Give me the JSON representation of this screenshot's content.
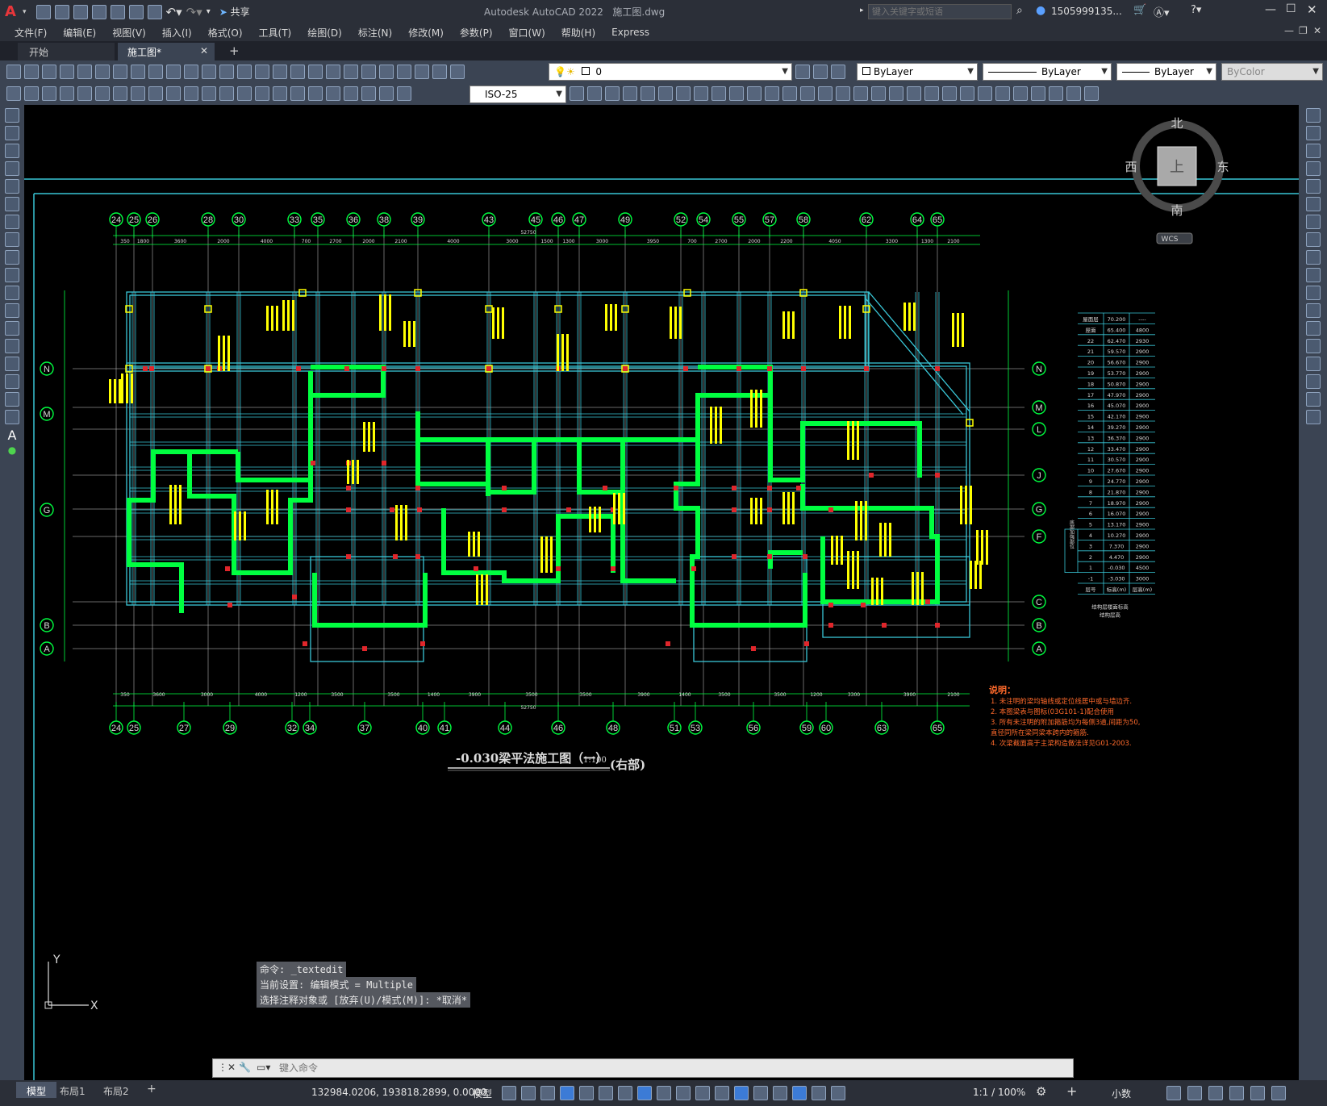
{
  "app": {
    "title": "Autodesk AutoCAD 2022",
    "file": "施工图.dwg",
    "search_placeholder": "键入关键字或短语",
    "user": "1505999135...",
    "share": "共享"
  },
  "menu": [
    "文件(F)",
    "编辑(E)",
    "视图(V)",
    "插入(I)",
    "格式(O)",
    "工具(T)",
    "绘图(D)",
    "标注(N)",
    "修改(M)",
    "参数(P)",
    "窗口(W)",
    "帮助(H)",
    "Express"
  ],
  "tabs": {
    "start": "开始",
    "active": "施工图*",
    "add": "+"
  },
  "toolbar": {
    "layer": "0",
    "color": "ByLayer",
    "linetype": "ByLayer",
    "lineweight": "ByLayer",
    "plotstyle": "ByColor",
    "dimstyle": "ISO-25"
  },
  "viewcube": {
    "north": "北",
    "south": "南",
    "west": "西",
    "east": "东",
    "top": "上",
    "wcs": "WCS"
  },
  "drawing": {
    "top_axes": [
      "24",
      "25",
      "26",
      "28",
      "30",
      "33",
      "35",
      "36",
      "38",
      "39",
      "43",
      "45",
      "46",
      "47",
      "49",
      "52",
      "54",
      "55",
      "57",
      "58",
      "62",
      "64",
      "65"
    ],
    "bottom_axes": [
      "24",
      "25",
      "27",
      "29",
      "32",
      "34",
      "37",
      "40",
      "41",
      "44",
      "46",
      "48",
      "51",
      "53",
      "56",
      "59",
      "60",
      "63",
      "65"
    ],
    "row_axes_left": [
      "N",
      "M",
      "G",
      "B",
      "A"
    ],
    "row_axes_right": [
      "N",
      "M",
      "L",
      "J",
      "G",
      "F",
      "C",
      "B",
      "A"
    ],
    "total_dim": "52750",
    "top_dims": [
      "350",
      "1800",
      "3600",
      "2000",
      "4000",
      "700",
      "2700",
      "2000",
      "2100",
      "4000",
      "3000",
      "1500",
      "1300",
      "3000",
      "3950",
      "700",
      "2700",
      "2000",
      "2200",
      "4050",
      "3300",
      "1300",
      "2100"
    ],
    "bottom_dims": [
      "350",
      "3600",
      "3000",
      "4000",
      "1200",
      "3500",
      "3500",
      "1400",
      "3900",
      "3500",
      "3500",
      "3900",
      "1400",
      "3500",
      "3500",
      "1200",
      "3300",
      "3900",
      "2100"
    ],
    "caption": "-0.030梁平法施工图（一）",
    "scale": "1:100",
    "caption_suffix": "(右部)",
    "notes_title": "说明：",
    "notes": [
      "1. 未注明的梁均轴线或定位线居中或与墙边齐.",
      "2. 本图梁表与图标(03G101-1)配合使用",
      "3. 所有未注明的附加箍筋均为每侧3道,间距为50,",
      "   直径同所在梁同梁本跨内的箍筋.",
      "4. 次梁截面高于主梁构造做法详见G01-2003."
    ],
    "floor_table": {
      "header": [
        "层号",
        "标高(m)",
        "层高(m)"
      ],
      "rows": [
        [
          "屋面层",
          "70.200",
          "----"
        ],
        [
          "屋面",
          "65.400",
          "4800"
        ],
        [
          "22",
          "62.470",
          "2930"
        ],
        [
          "21",
          "59.570",
          "2900"
        ],
        [
          "20",
          "56.670",
          "2900"
        ],
        [
          "19",
          "53.770",
          "2900"
        ],
        [
          "18",
          "50.870",
          "2900"
        ],
        [
          "17",
          "47.970",
          "2900"
        ],
        [
          "16",
          "45.070",
          "2900"
        ],
        [
          "15",
          "42.170",
          "2900"
        ],
        [
          "14",
          "39.270",
          "2900"
        ],
        [
          "13",
          "36.370",
          "2900"
        ],
        [
          "12",
          "33.470",
          "2900"
        ],
        [
          "11",
          "30.570",
          "2900"
        ],
        [
          "10",
          "27.670",
          "2900"
        ],
        [
          "9",
          "24.770",
          "2900"
        ],
        [
          "8",
          "21.870",
          "2900"
        ],
        [
          "7",
          "18.970",
          "2900"
        ],
        [
          "6",
          "16.070",
          "2900"
        ],
        [
          "5",
          "13.170",
          "2900"
        ],
        [
          "4",
          "10.270",
          "2900"
        ],
        [
          "3",
          "7.370",
          "2900"
        ],
        [
          "2",
          "4.470",
          "2900"
        ],
        [
          "1",
          "-0.030",
          "4500"
        ],
        [
          "-1",
          "-3.030",
          "3000"
        ]
      ],
      "side_label": "底部加强部位",
      "footer1": "结构层楼面标高",
      "footer2": "结构层高"
    }
  },
  "command": {
    "line1": "命令: _textedit",
    "line2": "当前设置: 编辑模式 = Multiple",
    "line3": "选择注释对象或 [放弃(U)/模式(M)]: *取消*",
    "placeholder": "键入命令"
  },
  "status": {
    "layouts": [
      "模型",
      "布局1",
      "布局2"
    ],
    "coords": "132984.0206, 193818.2899, 0.0000",
    "model": "模型",
    "scale": "1:1 / 100%",
    "units": "小数"
  },
  "ucs": {
    "x": "X",
    "y": "Y"
  }
}
